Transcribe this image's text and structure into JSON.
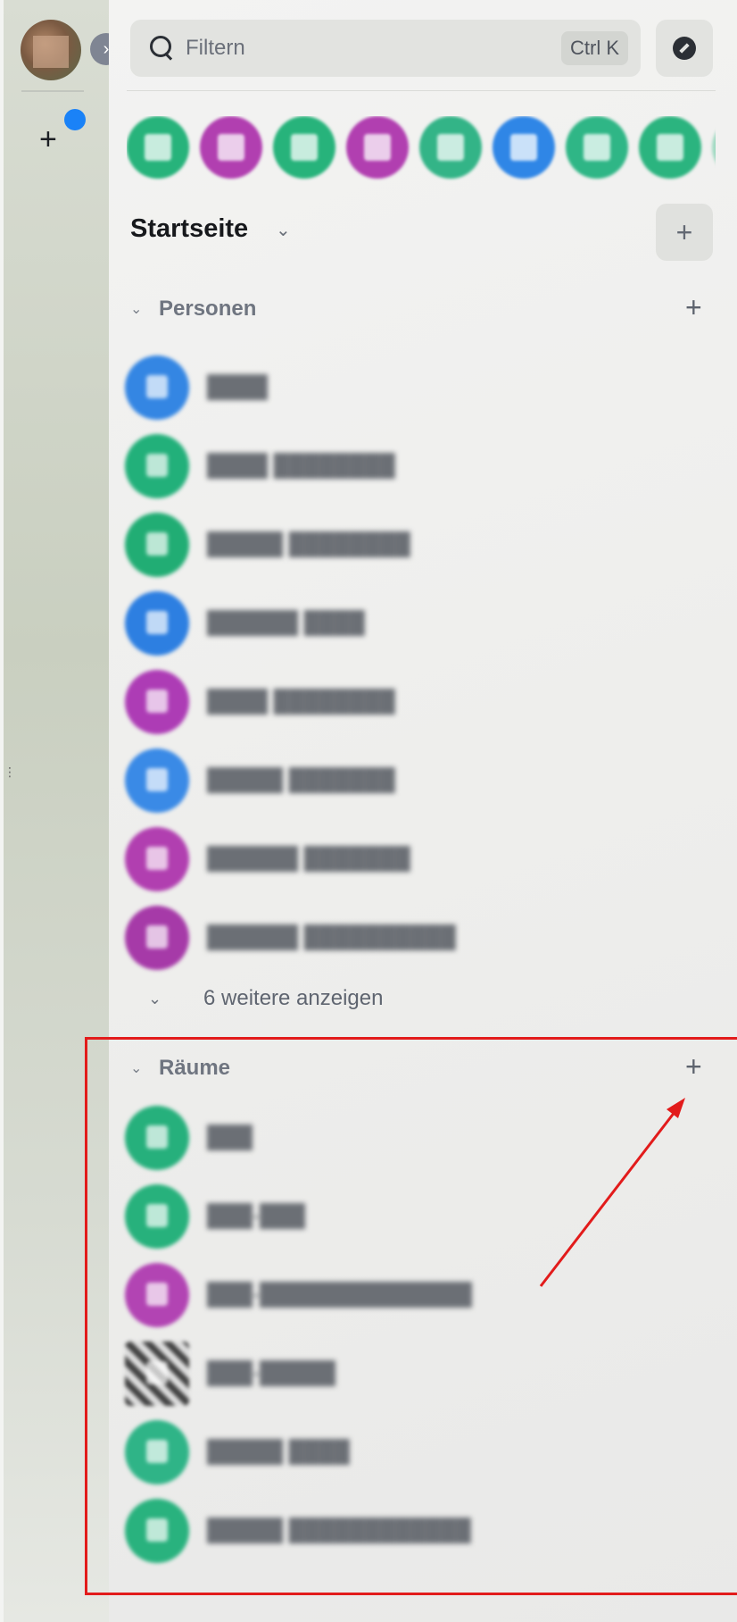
{
  "search": {
    "placeholder": "Filtern",
    "shortcut": "Ctrl K"
  },
  "home": {
    "title": "Startseite"
  },
  "recent_colors": [
    "#27b37b",
    "#b13fb0",
    "#27b37b",
    "#b13fb0",
    "#33b487",
    "#2f86e6",
    "#2fb686",
    "#2bb47f"
  ],
  "people": {
    "label": "Personen",
    "items": [
      {
        "name": "████",
        "color": "#3486e3"
      },
      {
        "name": "████ ████████",
        "color": "#22b07a"
      },
      {
        "name": "█████ ████████",
        "color": "#21ad74"
      },
      {
        "name": "██████ ████",
        "color": "#2d7fe1"
      },
      {
        "name": "████ ████████",
        "color": "#ad3cb5"
      },
      {
        "name": "█████ ███████",
        "color": "#3a8ae6"
      },
      {
        "name": "██████ ███████",
        "color": "#b13fb0"
      },
      {
        "name": "██████ ██████████",
        "color": "#a63aa8"
      }
    ],
    "show_more": "6 weitere anzeigen"
  },
  "rooms": {
    "label": "Räume",
    "items": [
      {
        "name": "███",
        "color": "#26b07c",
        "style": "solid"
      },
      {
        "name": "███-███",
        "color": "#27b17c",
        "style": "solid"
      },
      {
        "name": "███-██████████████",
        "color": "#b244b3",
        "style": "solid"
      },
      {
        "name": "███-█████",
        "color": "#888888",
        "style": "bw"
      },
      {
        "name": "█████ ████",
        "color": "#2fb487",
        "style": "solid"
      },
      {
        "name": "█████ ████████████",
        "color": "#29b27e",
        "style": "solid"
      }
    ]
  },
  "annotation": {
    "color": "#e21b1b"
  }
}
